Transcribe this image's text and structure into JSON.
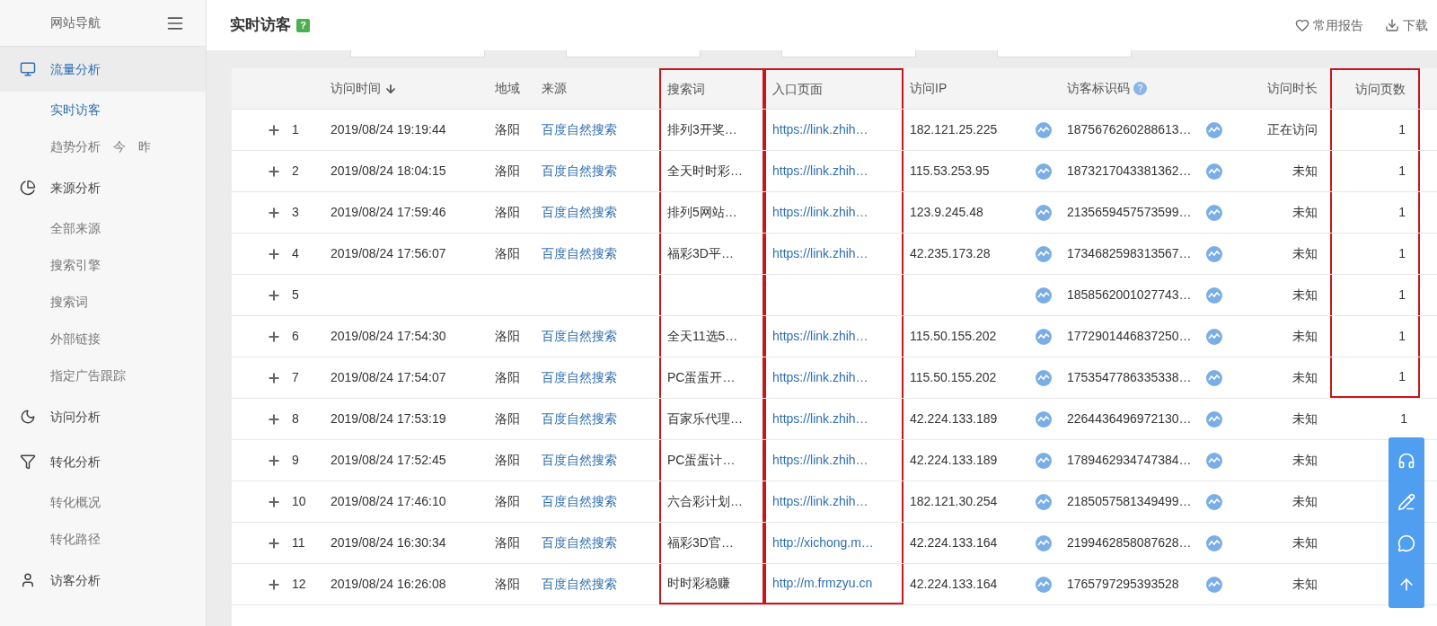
{
  "sidebar": {
    "title": "网站导航",
    "groups": [
      {
        "label": "流量分析",
        "selected": true,
        "children": [
          {
            "label": "实时访客",
            "selected": true
          },
          {
            "label": "趋势分析",
            "selected": false,
            "tags": [
              "今",
              "昨"
            ]
          }
        ]
      },
      {
        "label": "来源分析",
        "selected": false,
        "children": [
          {
            "label": "全部来源",
            "selected": false
          },
          {
            "label": "搜索引擎",
            "selected": false
          },
          {
            "label": "搜索词",
            "selected": false
          },
          {
            "label": "外部链接",
            "selected": false
          },
          {
            "label": "指定广告跟踪",
            "selected": false
          }
        ]
      },
      {
        "label": "访问分析",
        "selected": false
      },
      {
        "label": "转化分析",
        "selected": false,
        "children": [
          {
            "label": "转化概况",
            "selected": false
          },
          {
            "label": "转化路径",
            "selected": false
          }
        ]
      },
      {
        "label": "访客分析",
        "selected": false
      }
    ]
  },
  "header": {
    "title": "实时访客",
    "help": "?",
    "actions": [
      {
        "label": "常用报告"
      },
      {
        "label": "下载"
      }
    ]
  },
  "table": {
    "columns": [
      {
        "highlighted": false
      },
      {
        "label": "访问时间",
        "sorted": true,
        "highlighted": false
      },
      {
        "label": "地域",
        "highlighted": false
      },
      {
        "label": "来源",
        "highlighted": false
      },
      {
        "label": "搜索词",
        "highlighted": true
      },
      {
        "label": "入口页面",
        "highlighted": true
      },
      {
        "label": "访问IP",
        "highlighted": false
      },
      {
        "highlighted": false
      },
      {
        "label": "访客标识码",
        "help": "?",
        "highlighted": false
      },
      {
        "highlighted": false
      },
      {
        "label": "访问时长",
        "highlighted": false
      },
      {
        "label": "访问页数",
        "highlighted": true
      }
    ],
    "rows": [
      {
        "num": "1",
        "time": "2019/08/24 19:19:44",
        "region": "洛阳",
        "source": "百度自然搜索",
        "term": "排列3开奖…",
        "url": "https://link.zhih…",
        "ip": "182.121.25.225",
        "visitor_id": "1875676260288613…",
        "duration": "正在访问",
        "pages": "1",
        "pages_framed": true
      },
      {
        "num": "2",
        "time": "2019/08/24 18:04:15",
        "region": "洛阳",
        "source": "百度自然搜索",
        "term": "全天时时彩…",
        "url": "https://link.zhih…",
        "ip": "115.53.253.95",
        "visitor_id": "1873217043381362…",
        "duration": "未知",
        "pages": "1",
        "pages_framed": true
      },
      {
        "num": "3",
        "time": "2019/08/24 17:59:46",
        "region": "洛阳",
        "source": "百度自然搜索",
        "term": "排列5网站…",
        "url": "https://link.zhih…",
        "ip": "123.9.245.48",
        "visitor_id": "2135659457573599…",
        "duration": "未知",
        "pages": "1",
        "pages_framed": true
      },
      {
        "num": "4",
        "time": "2019/08/24 17:56:07",
        "region": "洛阳",
        "source": "百度自然搜索",
        "term": "福彩3D平…",
        "url": "https://link.zhih…",
        "ip": "42.235.173.28",
        "visitor_id": "1734682598313567…",
        "duration": "未知",
        "pages": "1",
        "pages_framed": true
      },
      {
        "num": "5",
        "visitor_id": "1858562001027743…",
        "duration": "未知",
        "pages": "1",
        "pages_framed": true
      },
      {
        "num": "6",
        "time": "2019/08/24 17:54:30",
        "region": "洛阳",
        "source": "百度自然搜索",
        "term": "全天11选5…",
        "url": "https://link.zhih…",
        "ip": "115.50.155.202",
        "visitor_id": "1772901446837250…",
        "duration": "未知",
        "pages": "1",
        "pages_framed": true
      },
      {
        "num": "7",
        "time": "2019/08/24 17:54:07",
        "region": "洛阳",
        "source": "百度自然搜索",
        "term": "PC蛋蛋开…",
        "url": "https://link.zhih…",
        "ip": "115.50.155.202",
        "visitor_id": "1753547786335338…",
        "duration": "未知",
        "pages": "1",
        "pages_framed": true
      },
      {
        "num": "8",
        "time": "2019/08/24 17:53:19",
        "region": "洛阳",
        "source": "百度自然搜索",
        "term": "百家乐代理…",
        "url": "https://link.zhih…",
        "ip": "42.224.133.189",
        "visitor_id": "2264436496972130…",
        "duration": "未知",
        "pages": "1",
        "pages_framed": false
      },
      {
        "num": "9",
        "time": "2019/08/24 17:52:45",
        "region": "洛阳",
        "source": "百度自然搜索",
        "term": "PC蛋蛋计…",
        "url": "https://link.zhih…",
        "ip": "42.224.133.189",
        "visitor_id": "1789462934747384…",
        "duration": "未知",
        "pages_framed": false
      },
      {
        "num": "10",
        "time": "2019/08/24 17:46:10",
        "region": "洛阳",
        "source": "百度自然搜索",
        "term": "六合彩计划…",
        "url": "https://link.zhih…",
        "ip": "182.121.30.254",
        "visitor_id": "2185057581349499…",
        "duration": "未知",
        "pages_framed": false
      },
      {
        "num": "11",
        "time": "2019/08/24 16:30:34",
        "region": "洛阳",
        "source": "百度自然搜索",
        "term": "福彩3D官…",
        "url": "http://xichong.m…",
        "ip": "42.224.133.164",
        "visitor_id": "2199462858087628…",
        "duration": "未知",
        "pages_framed": false
      },
      {
        "num": "12",
        "time": "2019/08/24 16:26:08",
        "region": "洛阳",
        "source": "百度自然搜索",
        "term": "时时彩稳赚",
        "url": "http://m.frmzyu.cn",
        "ip": "42.224.133.164",
        "visitor_id": "1765797295393528",
        "duration": "未知",
        "pages_framed": false
      }
    ]
  }
}
